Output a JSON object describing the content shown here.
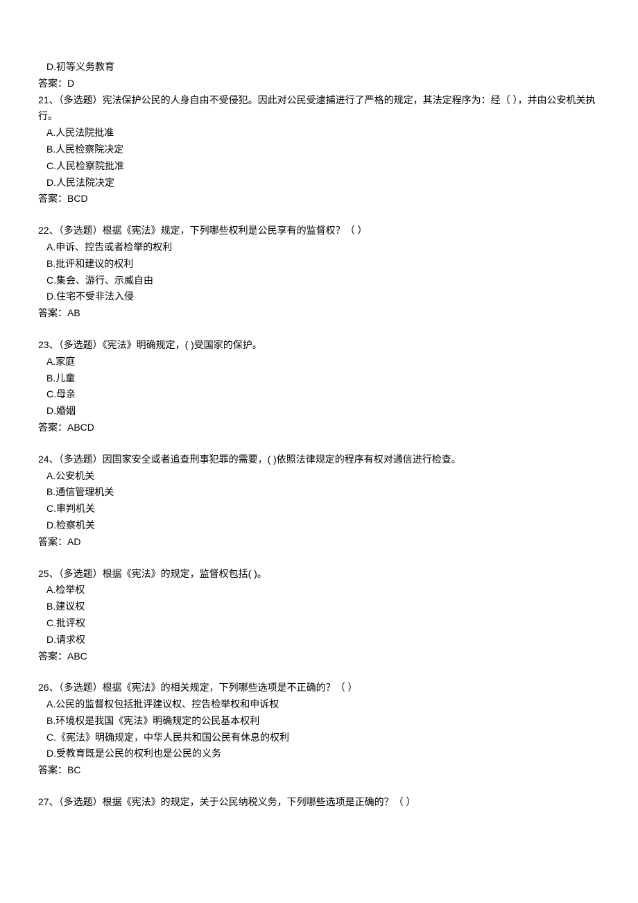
{
  "q20_tail": {
    "optionD": "D.初等义务教育",
    "answer": "答案：D"
  },
  "q21": {
    "question": "21、（多选题）宪法保护公民的人身自由不受侵犯。因此对公民受逮捕进行了严格的规定，其法定程序为：经（  ），并由公安机关执行。",
    "optionA": "A.人民法院批准",
    "optionB": "B.人民检察院决定",
    "optionC": "C.人民检察院批准",
    "optionD": "D.人民法院决定",
    "answer": "答案：BCD"
  },
  "q22": {
    "question": "22、（多选题）根据《宪法》规定，下列哪些权利是公民享有的监督权？（  ）",
    "optionA": "A.申诉、控告或者检举的权利",
    "optionB": "B.批评和建议的权利",
    "optionC": "C.集会、游行、示威自由",
    "optionD": "D.住宅不受非法入侵",
    "answer": "答案：AB"
  },
  "q23": {
    "question": "23、（多选题）《宪法》明确规定，(   )受国家的保护。",
    "optionA": "A.家庭",
    "optionB": "B.儿童",
    "optionC": "C.母亲",
    "optionD": "D.婚姻",
    "answer": "答案：ABCD"
  },
  "q24": {
    "question": "24、（多选题）因国家安全或者追查刑事犯罪的需要，(   )依照法律规定的程序有权对通信进行检查。",
    "optionA": "A.公安机关",
    "optionB": "B.通信管理机关",
    "optionC": "C.审判机关",
    "optionD": "D.检察机关",
    "answer": "答案：AD"
  },
  "q25": {
    "question": "25、（多选题）根据《宪法》的规定，监督权包括(   )。",
    "optionA": "A.检举权",
    "optionB": "B.建议权",
    "optionC": "C.批评权",
    "optionD": "D.请求权",
    "answer": "答案：ABC"
  },
  "q26": {
    "question": "26、（多选题）根据《宪法》的相关规定，下列哪些选项是不正确的？（  ）",
    "optionA": "A.公民的监督权包括批评建议权、控告检举权和申诉权",
    "optionB": "B.环境权是我国《宪法》明确规定的公民基本权利",
    "optionC": "C.《宪法》明确规定，中华人民共和国公民有休息的权利",
    "optionD": "D.受教育既是公民的权利也是公民的义务",
    "answer": "答案：BC"
  },
  "q27": {
    "question": "27、（多选题）根据《宪法》的规定，关于公民纳税义务，下列哪些选项是正确的？（  ）"
  }
}
